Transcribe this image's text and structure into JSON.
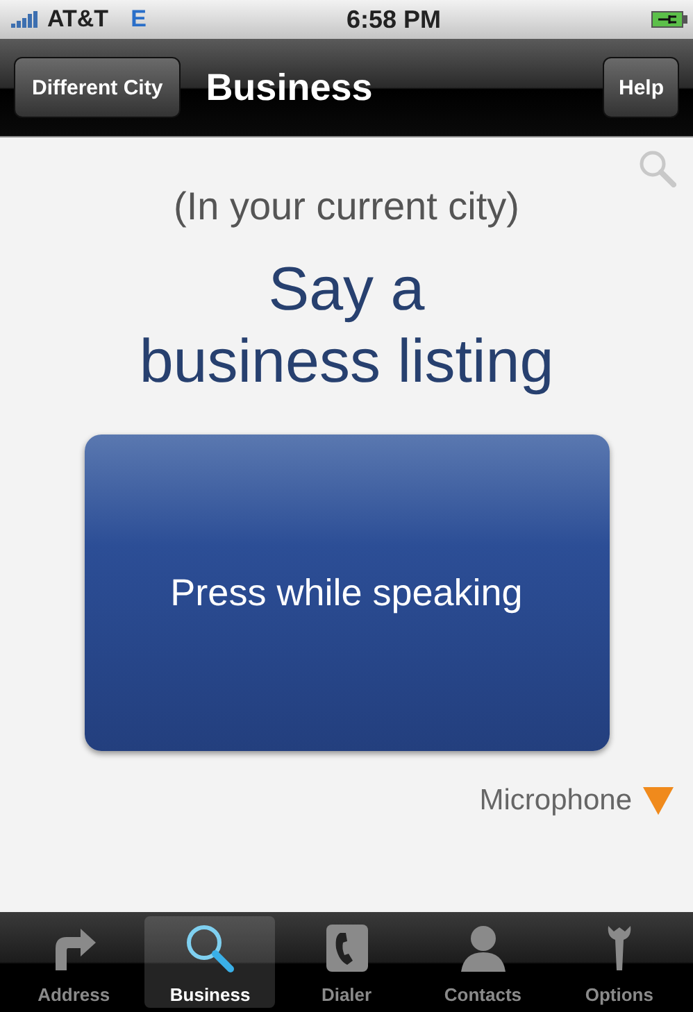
{
  "status_bar": {
    "carrier": "AT&T",
    "network": "E",
    "time": "6:58 PM"
  },
  "nav_bar": {
    "left_button": "Different City",
    "title": "Business",
    "right_button": "Help"
  },
  "content": {
    "subtitle": "(In your current city)",
    "heading_lines": [
      "Say a",
      "business listing"
    ],
    "speak_button": "Press while speaking",
    "microphone_label": "Microphone"
  },
  "tabs": [
    {
      "label": "Address",
      "selected": false
    },
    {
      "label": "Business",
      "selected": true
    },
    {
      "label": "Dialer",
      "selected": false
    },
    {
      "label": "Contacts",
      "selected": false
    },
    {
      "label": "Options",
      "selected": false
    }
  ]
}
